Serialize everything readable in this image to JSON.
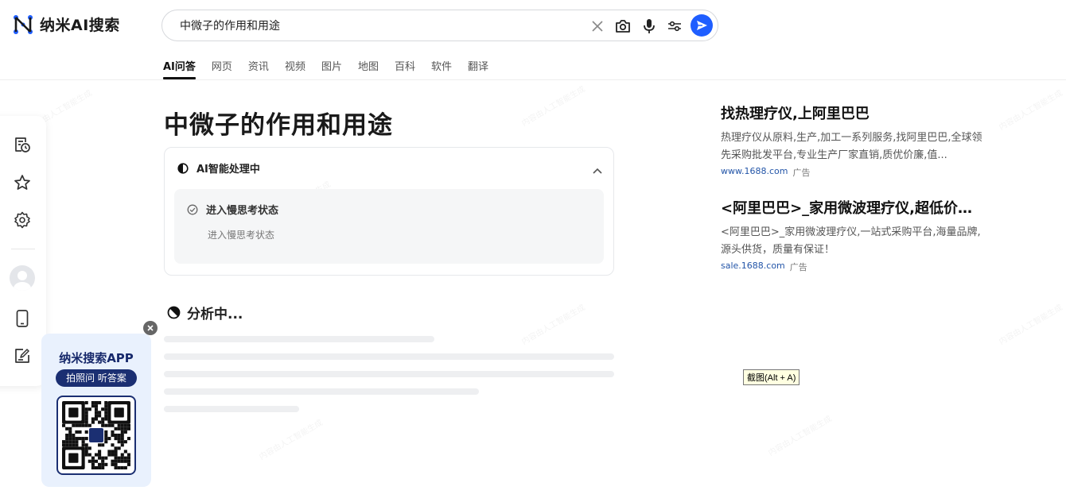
{
  "brand": {
    "name": "纳米AI搜索",
    "accent": "#1f5eff"
  },
  "search": {
    "query": "中微子的作用和用途"
  },
  "tabs": [
    {
      "label": "AI问答",
      "active": true
    },
    {
      "label": "网页"
    },
    {
      "label": "资讯"
    },
    {
      "label": "视频"
    },
    {
      "label": "图片"
    },
    {
      "label": "地图"
    },
    {
      "label": "百科"
    },
    {
      "label": "软件"
    },
    {
      "label": "翻译"
    }
  ],
  "main": {
    "title": "中微子的作用和用途",
    "ai_card": {
      "status": "AI智能处理中",
      "step_title": "进入慢思考状态",
      "step_sub": "进入慢思考状态"
    },
    "analyzing": "分析中..."
  },
  "promo": {
    "title": "纳米搜索APP",
    "pill": "拍照问 听答案"
  },
  "ads": [
    {
      "title": "找热理疗仪,上阿里巴巴",
      "desc": "热理疗仪从原料,生产,加工一系列服务,找阿里巴巴,全球领先采购批发平台,专业生产厂家直销,质优价廉,值...",
      "url": "www.1688.com",
      "tag": "广告"
    },
    {
      "title": "<阿里巴巴>_家用微波理疗仪,超低价供...",
      "desc": "<阿里巴巴>_家用微波理疗仪,一站式采购平台,海量品牌,源头供货，质量有保证！",
      "url": "sale.1688.com",
      "tag": "广告"
    }
  ],
  "tooltip": "截图(Alt + A)",
  "watermark": "内容由人工智能生成"
}
